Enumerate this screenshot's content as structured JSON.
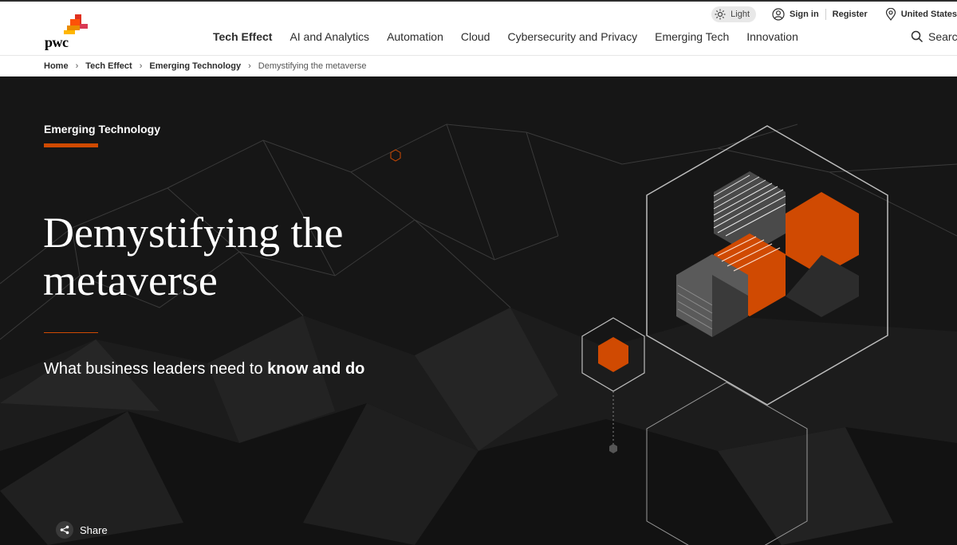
{
  "header": {
    "logo_text": "pwc",
    "theme_toggle_label": "Light",
    "sign_in": "Sign in",
    "register": "Register",
    "region": "United States",
    "search_label": "Search",
    "nav": [
      {
        "label": "Tech Effect",
        "active": true
      },
      {
        "label": "AI and Analytics"
      },
      {
        "label": "Automation"
      },
      {
        "label": "Cloud"
      },
      {
        "label": "Cybersecurity and Privacy"
      },
      {
        "label": "Emerging Tech"
      },
      {
        "label": "Innovation"
      }
    ]
  },
  "breadcrumb": [
    "Home",
    "Tech Effect",
    "Emerging Technology",
    "Demystifying the metaverse"
  ],
  "hero": {
    "eyebrow": "Emerging Technology",
    "title_line1": "Demystifying the",
    "title_line2": "metaverse",
    "subtitle_plain": "What business leaders need to ",
    "subtitle_bold": "know and do",
    "share_label": "Share"
  },
  "colors": {
    "accent": "#d04a02",
    "hero_bg": "#161616",
    "text_dark": "#2d2d2d"
  }
}
